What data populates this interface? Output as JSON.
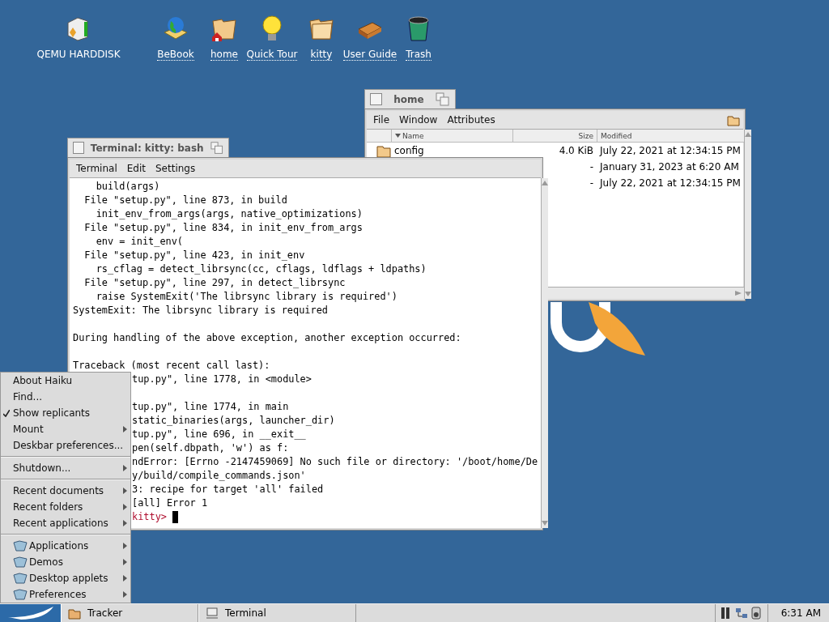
{
  "desktop_icons": [
    {
      "label": "QEMU HARDDISK",
      "kind": "disk",
      "link": false
    },
    {
      "label": "BeBook",
      "kind": "book",
      "link": true
    },
    {
      "label": "home",
      "kind": "home",
      "link": true
    },
    {
      "label": "Quick Tour",
      "kind": "bulb",
      "link": true
    },
    {
      "label": "kitty",
      "kind": "folder",
      "link": true
    },
    {
      "label": "User Guide",
      "kind": "guide",
      "link": true
    },
    {
      "label": "Trash",
      "kind": "trash",
      "link": true
    }
  ],
  "home_window": {
    "title": "home",
    "menu": [
      "File",
      "Window",
      "Attributes"
    ],
    "columns": [
      "Name",
      "Size",
      "Modified"
    ],
    "rows": [
      {
        "name": "config",
        "size": "4.0 KiB",
        "modified": "July 22, 2021 at 12:34:15 PM"
      },
      {
        "size": "-",
        "modified": "January 31, 2023 at 6:20 AM"
      },
      {
        "size": "-",
        "modified": "July 22, 2021 at 12:34:15 PM"
      }
    ]
  },
  "terminal_window": {
    "title": "Terminal: kitty: bash",
    "menu": [
      "Terminal",
      "Edit",
      "Settings"
    ],
    "lines": [
      {
        "kind": "text",
        "text": "    build(args)"
      },
      {
        "kind": "text",
        "text": "  File \"setup.py\", line 873, in build"
      },
      {
        "kind": "text",
        "text": "    init_env_from_args(args, native_optimizations)"
      },
      {
        "kind": "text",
        "text": "  File \"setup.py\", line 834, in init_env_from_args"
      },
      {
        "kind": "text",
        "text": "    env = init_env("
      },
      {
        "kind": "text",
        "text": "  File \"setup.py\", line 423, in init_env"
      },
      {
        "kind": "text",
        "text": "    rs_cflag = detect_librsync(cc, cflags, ldflags + ldpaths)"
      },
      {
        "kind": "text",
        "text": "  File \"setup.py\", line 297, in detect_librsync"
      },
      {
        "kind": "text",
        "text": "    raise SystemExit('The librsync library is required')"
      },
      {
        "kind": "text",
        "text": "SystemExit: The librsync library is required"
      },
      {
        "kind": "blank"
      },
      {
        "kind": "text",
        "text": "During handling of the above exception, another exception occurred:"
      },
      {
        "kind": "blank"
      },
      {
        "kind": "text",
        "text": "Traceback (most recent call last):"
      }
    ],
    "lines_beside_menu": [
      {
        "kind": "text",
        "text": "tup.py\", line 1778, in <module>"
      },
      {
        "kind": "blank"
      },
      {
        "kind": "text",
        "text": "tup.py\", line 1774, in main"
      },
      {
        "kind": "text",
        "text": "static_binaries(args, launcher_dir)"
      },
      {
        "kind": "text",
        "text": "tup.py\", line 696, in __exit__"
      },
      {
        "kind": "text",
        "text": "pen(self.dbpath, 'w') as f:"
      },
      {
        "kind": "text",
        "text": "ndError: [Errno -2147459069] No such file or directory: '/boot/home/De"
      },
      {
        "kind": "text",
        "text": "y/build/compile_commands.json'"
      },
      {
        "kind": "text",
        "text": "3: recipe for target 'all' failed"
      },
      {
        "kind": "text",
        "text": "[all] Error 1"
      },
      {
        "kind": "prompt",
        "text": "kitty>"
      }
    ]
  },
  "deskbar_menu": {
    "groups": [
      [
        {
          "label": "About Haiku",
          "checked": false,
          "submenu": false,
          "folder": false
        },
        {
          "label": "Find...",
          "checked": false,
          "submenu": false,
          "folder": false
        },
        {
          "label": "Show replicants",
          "checked": true,
          "submenu": false,
          "folder": false
        },
        {
          "label": "Mount",
          "checked": false,
          "submenu": true,
          "folder": false
        },
        {
          "label": "Deskbar preferences...",
          "checked": false,
          "submenu": false,
          "folder": false
        }
      ],
      [
        {
          "label": "Shutdown...",
          "checked": false,
          "submenu": true,
          "folder": false
        }
      ],
      [
        {
          "label": "Recent documents",
          "checked": false,
          "submenu": true,
          "folder": false
        },
        {
          "label": "Recent folders",
          "checked": false,
          "submenu": true,
          "folder": false
        },
        {
          "label": "Recent applications",
          "checked": false,
          "submenu": true,
          "folder": false
        }
      ],
      [
        {
          "label": "Applications",
          "checked": false,
          "submenu": true,
          "folder": true
        },
        {
          "label": "Demos",
          "checked": false,
          "submenu": true,
          "folder": true
        },
        {
          "label": "Desktop applets",
          "checked": false,
          "submenu": true,
          "folder": true
        },
        {
          "label": "Preferences",
          "checked": false,
          "submenu": true,
          "folder": true
        }
      ]
    ]
  },
  "taskbar": {
    "apps": [
      {
        "label": "Tracker",
        "kind": "tracker"
      },
      {
        "label": "Terminal",
        "kind": "terminal"
      }
    ],
    "clock": "6:31 AM"
  }
}
